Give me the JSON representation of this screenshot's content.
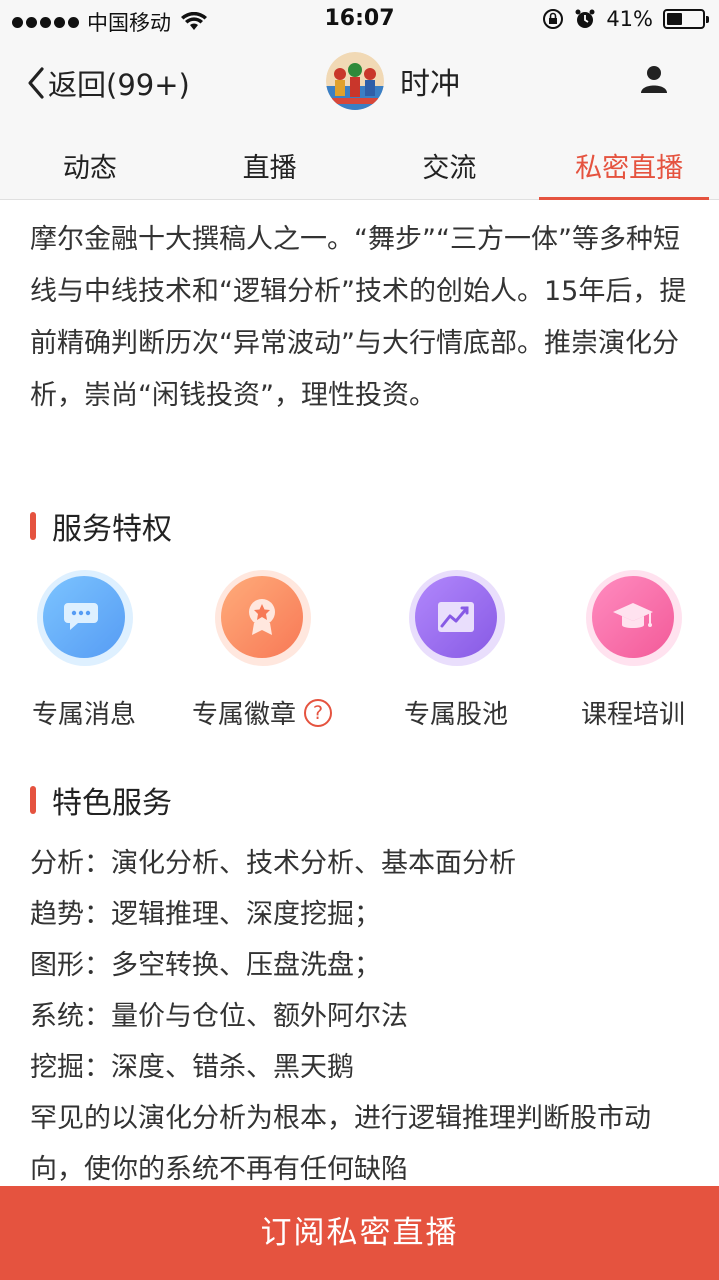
{
  "status_bar": {
    "carrier": "中国移动",
    "time": "16:07",
    "battery": "41%"
  },
  "nav": {
    "back_label": "返回(99+)",
    "title": "时冲"
  },
  "tabs": [
    {
      "label": "动态"
    },
    {
      "label": "直播"
    },
    {
      "label": "交流"
    },
    {
      "label": "私密直播",
      "active": true
    }
  ],
  "intro_text": "摩尔金融十大撰稿人之一。“舞步”“三方一体”等多种短线与中线技术和“逻辑分析”技术的创始人。15年后，提前精确判断历次“异常波动”与大行情底部。推崇演化分析，崇尚“闲钱投资”，理性投资。",
  "privileges": {
    "title": "服务特权",
    "items": [
      {
        "label": "专属消息",
        "icon": "chat-bubble-icon",
        "color": "#5aa8f5"
      },
      {
        "label": "专属徽章",
        "icon": "badge-medal-icon",
        "color": "#f5825a",
        "help": "?"
      },
      {
        "label": "专属股池",
        "icon": "stock-chart-icon",
        "color": "#9b6cf0"
      },
      {
        "label": "课程培训",
        "icon": "graduation-cap-icon",
        "color": "#f55a9b"
      }
    ]
  },
  "featured": {
    "title": "特色服务",
    "lines": [
      "分析：演化分析、技术分析、基本面分析",
      "趋势：逻辑推理、深度挖掘；",
      "图形：多空转换、压盘洗盘；",
      "系统：量价与仓位、额外阿尔法",
      "挖掘：深度、错杀、黑天鹅",
      "罕见的以演化分析为根本，进行逻辑推理判断股市动向，使你的系统不再有任何缺陷"
    ]
  },
  "subscribe_label": "订阅私密直播",
  "accent_color": "#e5533f"
}
